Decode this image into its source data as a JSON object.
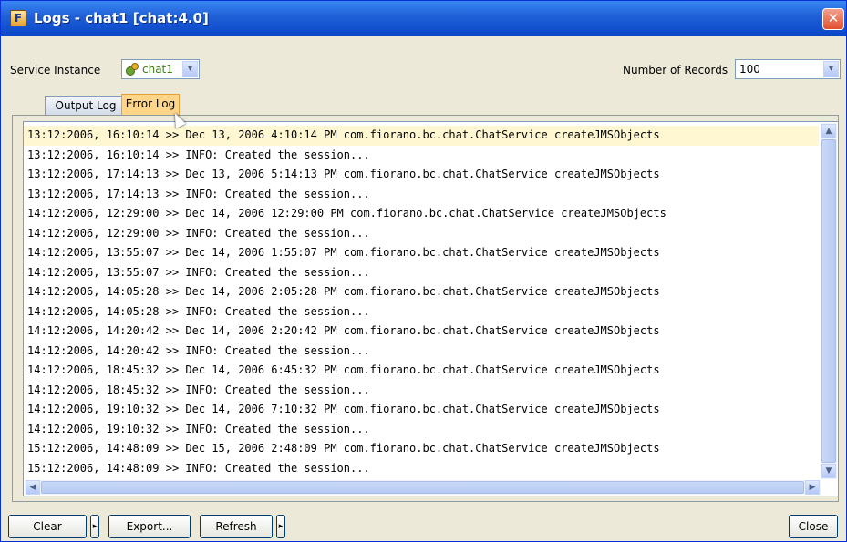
{
  "window": {
    "title": "Logs - chat1 [chat:4.0]",
    "close_glyph": "✕",
    "app_icon_letter": "F"
  },
  "service": {
    "label": "Service Instance",
    "value": "chat1",
    "icon": "service-component-icon"
  },
  "records": {
    "label": "Number of Records",
    "value": "100"
  },
  "tabs": [
    {
      "label": "Output Log"
    },
    {
      "label": "Error Log"
    }
  ],
  "log_lines": [
    "13:12:2006, 16:10:14 >> Dec 13, 2006 4:10:14 PM com.fiorano.bc.chat.ChatService createJMSObjects",
    "13:12:2006, 16:10:14 >> INFO: Created the session...",
    "13:12:2006, 17:14:13 >> Dec 13, 2006 5:14:13 PM com.fiorano.bc.chat.ChatService createJMSObjects",
    "13:12:2006, 17:14:13 >> INFO: Created the session...",
    "14:12:2006, 12:29:00 >> Dec 14, 2006 12:29:00 PM com.fiorano.bc.chat.ChatService createJMSObjects",
    "14:12:2006, 12:29:00 >> INFO: Created the session...",
    "14:12:2006, 13:55:07 >> Dec 14, 2006 1:55:07 PM com.fiorano.bc.chat.ChatService createJMSObjects",
    "14:12:2006, 13:55:07 >> INFO: Created the session...",
    "14:12:2006, 14:05:28 >> Dec 14, 2006 2:05:28 PM com.fiorano.bc.chat.ChatService createJMSObjects",
    "14:12:2006, 14:05:28 >> INFO: Created the session...",
    "14:12:2006, 14:20:42 >> Dec 14, 2006 2:20:42 PM com.fiorano.bc.chat.ChatService createJMSObjects",
    "14:12:2006, 14:20:42 >> INFO: Created the session...",
    "14:12:2006, 18:45:32 >> Dec 14, 2006 6:45:32 PM com.fiorano.bc.chat.ChatService createJMSObjects",
    "14:12:2006, 18:45:32 >> INFO: Created the session...",
    "14:12:2006, 19:10:32 >> Dec 14, 2006 7:10:32 PM com.fiorano.bc.chat.ChatService createJMSObjects",
    "14:12:2006, 19:10:32 >> INFO: Created the session...",
    "15:12:2006, 14:48:09 >> Dec 15, 2006 2:48:09 PM com.fiorano.bc.chat.ChatService createJMSObjects",
    "15:12:2006, 14:48:09 >> INFO: Created the session..."
  ],
  "buttons": {
    "clear": "Clear",
    "export": "Export...",
    "refresh": "Refresh",
    "close": "Close"
  },
  "icons": {
    "dropdown": "▾",
    "up": "▲",
    "down": "▼",
    "left": "◀",
    "right": "▶",
    "split": "▸"
  }
}
